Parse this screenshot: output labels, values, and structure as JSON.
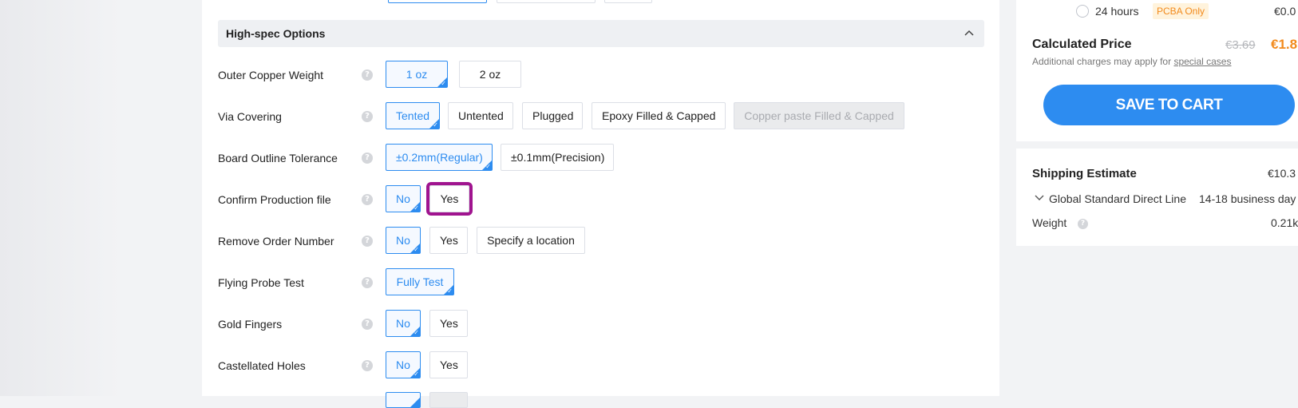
{
  "high_spec": {
    "title": "High-spec Options",
    "rows": [
      {
        "label": "Outer Copper Weight",
        "options": [
          "1 oz",
          "2 oz"
        ],
        "selected": "1 oz"
      },
      {
        "label": "Via Covering",
        "options": [
          "Tented",
          "Untented",
          "Plugged",
          "Epoxy Filled & Capped",
          "Copper paste Filled & Capped"
        ],
        "selected": "Tented",
        "disabled": [
          "Copper paste Filled & Capped"
        ]
      },
      {
        "label": "Board Outline Tolerance",
        "options": [
          "±0.2mm(Regular)",
          "±0.1mm(Precision)"
        ],
        "selected": "±0.2mm(Regular)"
      },
      {
        "label": "Confirm Production file",
        "options": [
          "No",
          "Yes"
        ],
        "selected": "No",
        "highlighted": "Yes"
      },
      {
        "label": "Remove Order Number",
        "options": [
          "No",
          "Yes",
          "Specify a location"
        ],
        "selected": "No"
      },
      {
        "label": "Flying Probe Test",
        "options": [
          "Fully Test"
        ],
        "selected": "Fully Test"
      },
      {
        "label": "Gold Fingers",
        "options": [
          "No",
          "Yes"
        ],
        "selected": "No"
      },
      {
        "label": "Castellated Holes",
        "options": [
          "No",
          "Yes"
        ],
        "selected": "No"
      }
    ]
  },
  "price_panel": {
    "build_time_option": "24 hours",
    "pcba_badge": "PCBA Only",
    "build_time_price": "€0.0",
    "calculated_price_label": "Calculated Price",
    "old_price": "€3.69",
    "new_price": "€1.8",
    "note_prefix": "Additional charges may apply for",
    "note_link": "special cases",
    "save_button": "SAVE TO CART"
  },
  "shipping": {
    "title": "Shipping Estimate",
    "price": "€10.3",
    "method": "Global Standard Direct Line",
    "days": "14-18 business day",
    "weight_label": "Weight",
    "weight_value": "0.21k"
  },
  "colors": {
    "accent": "#2d8cf0",
    "highlight": "#a0148f",
    "price_orange": "#f28a1c"
  },
  "icons": {
    "help": "question-circle-icon",
    "collapse": "chevron-up-icon",
    "expand": "chevron-down-icon",
    "selected": "corner-check-icon"
  }
}
